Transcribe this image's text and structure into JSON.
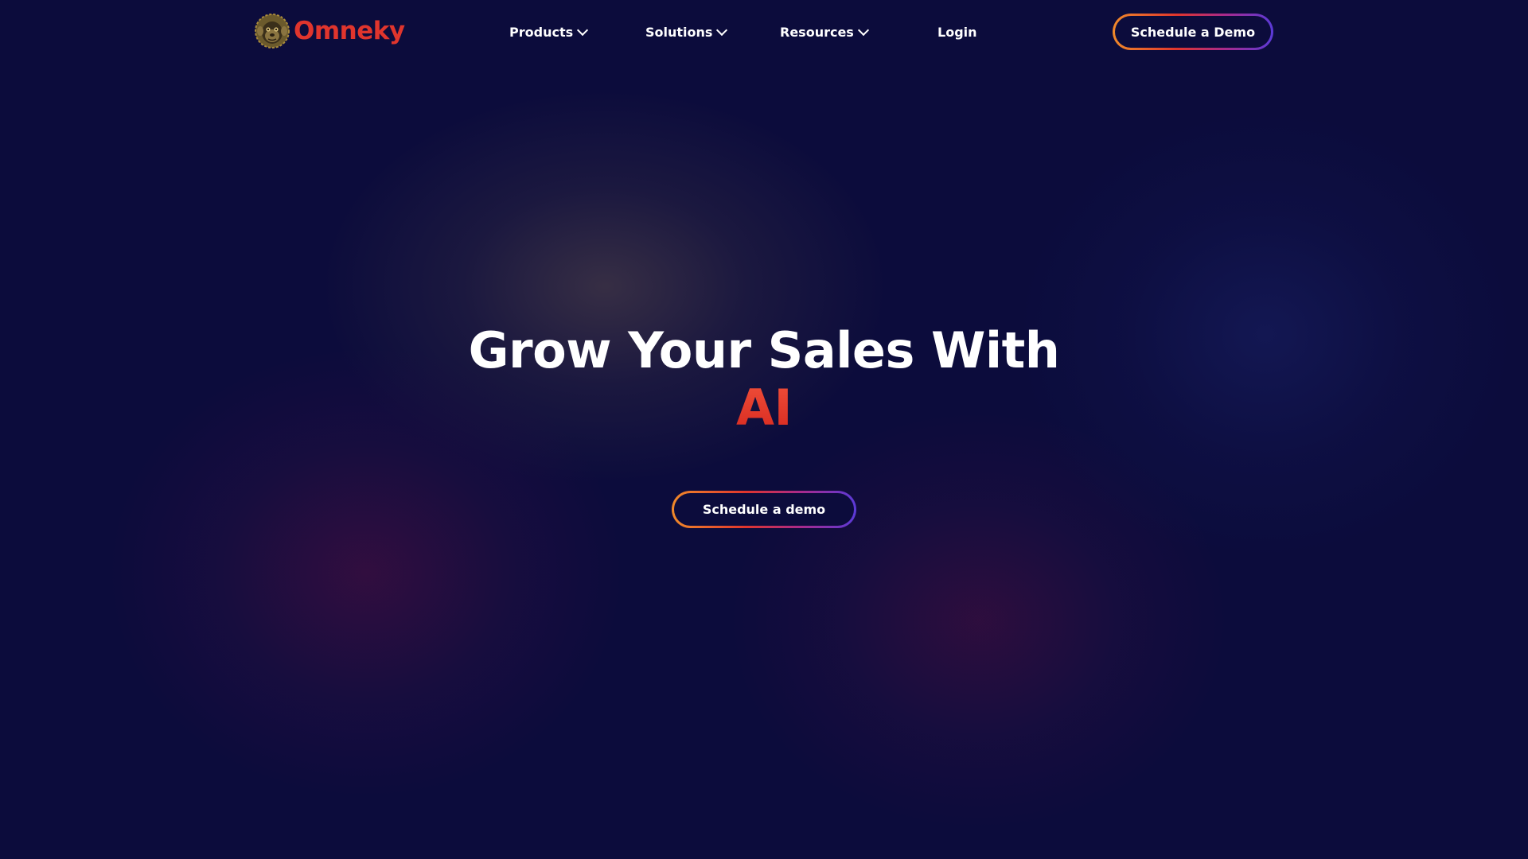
{
  "brand": {
    "name": "Omneky",
    "logo_icon": "monkey-head-icon",
    "color": "#e0352d"
  },
  "nav": {
    "items": [
      {
        "label": "Products",
        "has_dropdown": true
      },
      {
        "label": "Solutions",
        "has_dropdown": true
      },
      {
        "label": "Resources",
        "has_dropdown": true
      },
      {
        "label": "Login",
        "has_dropdown": false
      }
    ],
    "cta_label": "Schedule a Demo"
  },
  "hero": {
    "title_line1": "Grow Your Sales With",
    "title_accent": "AI",
    "cta_label": "Schedule a demo"
  },
  "colors": {
    "background": "#0c0c3c",
    "accent_red": "#e0352d",
    "gradient_start": "#f08a2a",
    "gradient_end": "#5a3ad8"
  }
}
